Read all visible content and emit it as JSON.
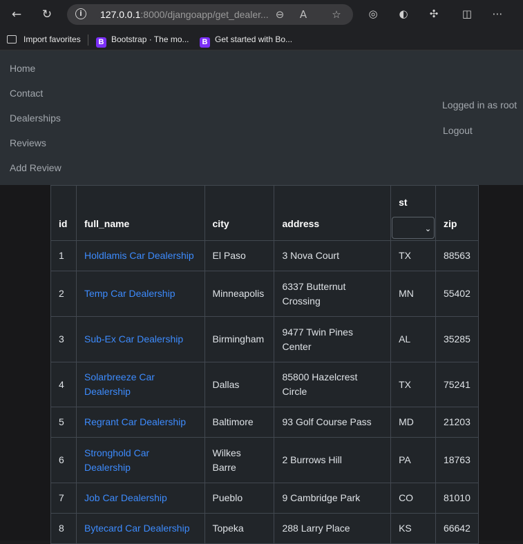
{
  "browser": {
    "url_host": "127.0.0.1",
    "url_rest": ":8000/djangoapp/get_dealer...",
    "favorites": [
      {
        "label": "Import favorites"
      },
      {
        "label": "Bootstrap · The mo..."
      },
      {
        "label": "Get started with Bo..."
      }
    ]
  },
  "navbar": {
    "links": [
      "Home",
      "Contact",
      "Dealerships",
      "Reviews",
      "Add Review"
    ],
    "user_status": "Logged in as root",
    "logout": "Logout"
  },
  "table": {
    "headers": {
      "id": "id",
      "full_name": "full_name",
      "city": "city",
      "address": "address",
      "st": "st",
      "zip": "zip"
    },
    "rows": [
      {
        "id": "1",
        "full_name": "Holdlamis Car Dealership",
        "city": "El Paso",
        "address": "3 Nova Court",
        "st": "TX",
        "zip": "88563"
      },
      {
        "id": "2",
        "full_name": "Temp Car Dealership",
        "city": "Minneapolis",
        "address": "6337 Butternut Crossing",
        "st": "MN",
        "zip": "55402"
      },
      {
        "id": "3",
        "full_name": "Sub-Ex Car Dealership",
        "city": "Birmingham",
        "address": "9477 Twin Pines Center",
        "st": "AL",
        "zip": "35285"
      },
      {
        "id": "4",
        "full_name": "Solarbreeze Car Dealership",
        "city": "Dallas",
        "address": "85800 Hazelcrest Circle",
        "st": "TX",
        "zip": "75241"
      },
      {
        "id": "5",
        "full_name": "Regrant Car Dealership",
        "city": "Baltimore",
        "address": "93 Golf Course Pass",
        "st": "MD",
        "zip": "21203"
      },
      {
        "id": "6",
        "full_name": "Stronghold Car Dealership",
        "city": "Wilkes Barre",
        "address": "2 Burrows Hill",
        "st": "PA",
        "zip": "18763"
      },
      {
        "id": "7",
        "full_name": "Job Car Dealership",
        "city": "Pueblo",
        "address": "9 Cambridge Park",
        "st": "CO",
        "zip": "81010"
      },
      {
        "id": "8",
        "full_name": "Bytecard Car Dealership",
        "city": "Topeka",
        "address": "288 Larry Place",
        "st": "KS",
        "zip": "66642"
      }
    ]
  },
  "colors": {
    "link": "#3d8bfd",
    "navbar_bg": "#2b3035",
    "table_bg": "#212529"
  }
}
